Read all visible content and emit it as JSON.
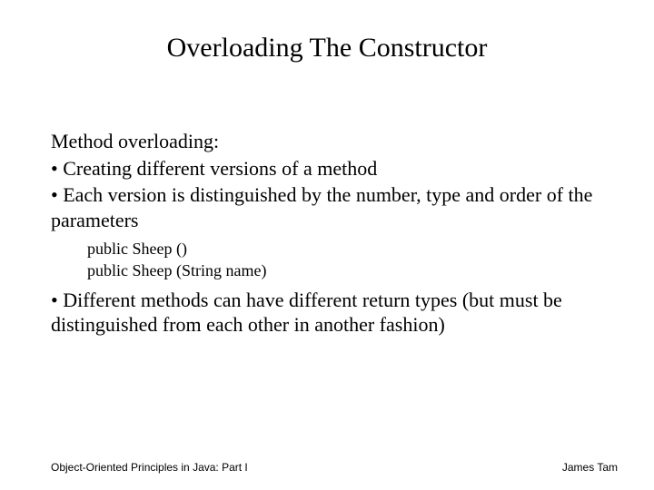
{
  "title": "Overloading The Constructor",
  "body": {
    "intro": "Method overloading:",
    "b1": "• Creating different versions of a method",
    "b2": "• Each version is distinguished by the number, type and order of the parameters",
    "code1": "public Sheep ()",
    "code2": "public Sheep (String name)",
    "b3": "• Different methods can have different return types (but must be distinguished from each other in another fashion)"
  },
  "footer": {
    "left": "Object-Oriented Principles in Java: Part I",
    "right": "James Tam"
  }
}
